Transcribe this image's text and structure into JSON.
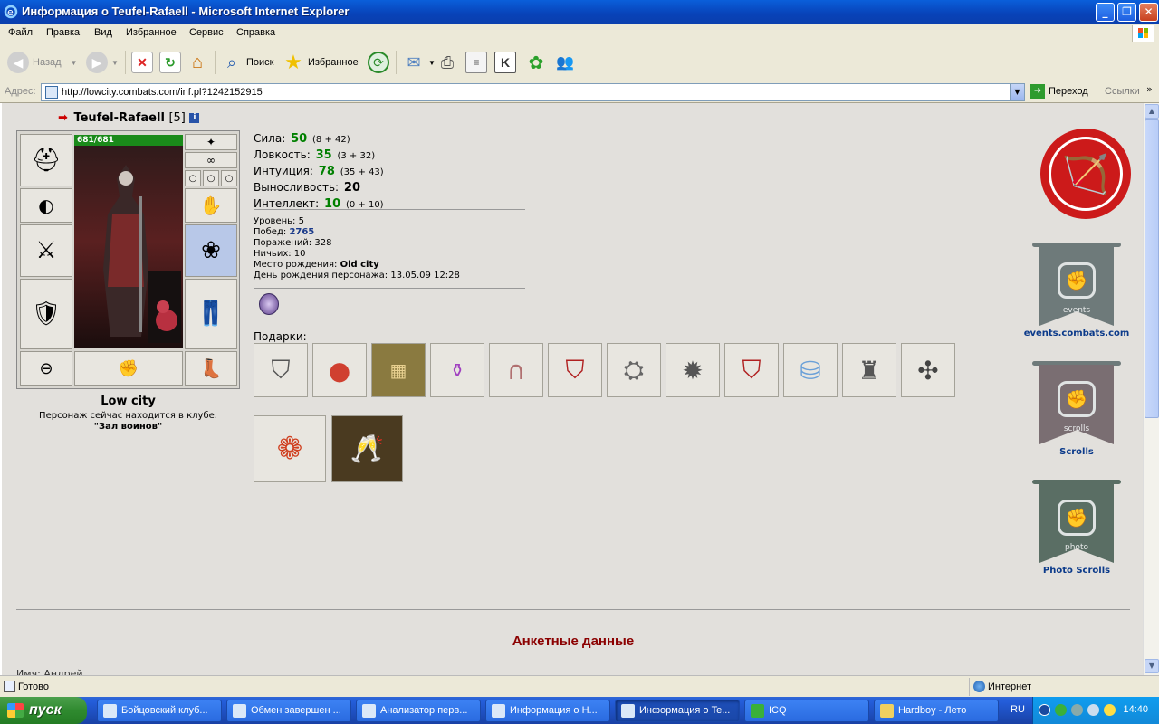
{
  "window": {
    "title": "Информация о Teufel-Rafaell - Microsoft Internet Explorer",
    "minimize": "_",
    "maximize": "❐",
    "close": "✕"
  },
  "menu": [
    "Файл",
    "Правка",
    "Вид",
    "Избранное",
    "Сервис",
    "Справка"
  ],
  "toolbar": {
    "back": "Назад",
    "search": "Поиск",
    "favorites": "Избранное"
  },
  "address": {
    "label": "Адрес:",
    "url": "http://lowcity.combats.com/inf.pl?1242152915",
    "go": "Переход",
    "links": "Ссылки"
  },
  "character": {
    "name": "Teufel-Rafaell",
    "level": "[5]",
    "hp": "681/681",
    "city": "Low city",
    "location_text": "Персонаж сейчас находится в клубе.",
    "room": "\"Зал воинов\""
  },
  "stats": [
    {
      "label": "Сила:",
      "value": "50",
      "detail": "(8 + 42)"
    },
    {
      "label": "Ловкость:",
      "value": "35",
      "detail": "(3 + 32)"
    },
    {
      "label": "Интуиция:",
      "value": "78",
      "detail": "(35 + 43)"
    },
    {
      "label": "Выносливость:",
      "value": "20",
      "detail": ""
    },
    {
      "label": "Интеллект:",
      "value": "10",
      "detail": "(0 + 10)"
    }
  ],
  "details": {
    "level_label": "Уровень:",
    "level": "5",
    "wins_label": "Побед:",
    "wins": "2765",
    "losses_label": "Поражений:",
    "losses": "328",
    "draws_label": "Ничьих:",
    "draws": "10",
    "birthplace_label": "Место рождения:",
    "birthplace": "Old city",
    "birthday_label": "День рождения персонажа:",
    "birthday": "13.05.09 12:28"
  },
  "gifts_label": "Подарки:",
  "sidebar_links": {
    "events": "events.combats.com",
    "scrolls": "Scrolls",
    "photo": "Photo Scrolls",
    "events_banner": "events",
    "scrolls_banner": "scrolls",
    "photo_banner": "photo"
  },
  "section_title": "Анкетные данные",
  "cutoff_text": "Имя: Андрей",
  "status": {
    "text": "Готово",
    "zone": "Интернет"
  },
  "taskbar": {
    "start": "пуск",
    "tasks": [
      "Бойцовский клуб...",
      "Обмен завершен ...",
      "Анализатор перв...",
      "Информация о Н...",
      "Информация о Te...",
      "ICQ",
      "Hardboy - Лето"
    ],
    "lang": "RU",
    "time": "14:40"
  }
}
